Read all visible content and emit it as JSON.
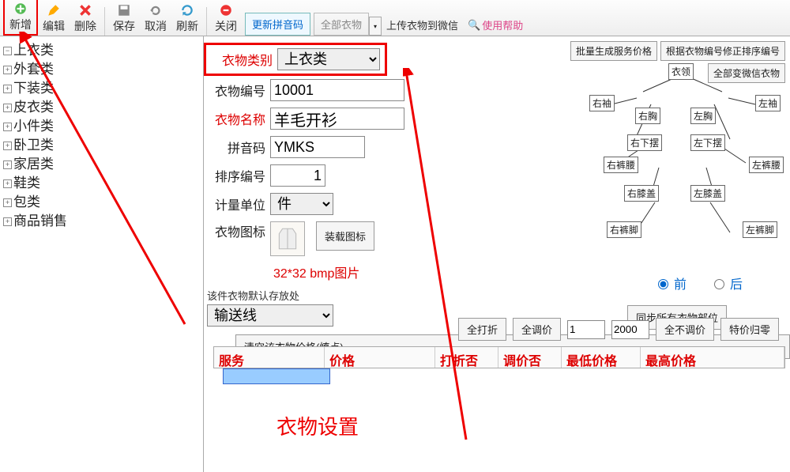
{
  "toolbar": {
    "new_label": "新增",
    "edit_label": "编辑",
    "delete_label": "删除",
    "save_label": "保存",
    "cancel_label": "取消",
    "refresh_label": "刷新",
    "close_label": "关闭",
    "update_pinyin": "更新拼音码",
    "all_clothes": "全部衣物",
    "upload_wechat": "上传衣物到微信",
    "help": "使用帮助"
  },
  "right_buttons": {
    "batch_price": "批量生成服务价格",
    "fix_sort": "根据衣物编号修正排序编号",
    "all_wechat": "全部变微信衣物"
  },
  "tree": {
    "items": [
      {
        "label": "上衣类"
      },
      {
        "label": "外套类"
      },
      {
        "label": "下装类"
      },
      {
        "label": "皮衣类"
      },
      {
        "label": "小件类"
      },
      {
        "label": "卧卫类"
      },
      {
        "label": "家居类"
      },
      {
        "label": "鞋类"
      },
      {
        "label": "包类"
      },
      {
        "label": "商品销售"
      }
    ]
  },
  "form": {
    "category_label": "衣物类别",
    "category_value": "上衣类",
    "number_label": "衣物编号",
    "number_value": "10001",
    "name_label": "衣物名称",
    "name_value": "羊毛开衫",
    "pinyin_label": "拼音码",
    "pinyin_value": "YMKS",
    "sort_label": "排序编号",
    "sort_value": "1",
    "unit_label": "计量单位",
    "unit_value": "件",
    "icon_label": "衣物图标",
    "load_icon": "装载图标",
    "icon_note": "32*32 bmp图片",
    "store_label": "该件衣物默认存放处",
    "store_value": "输送线",
    "clear_btn": "清空该衣物价格(慎点)"
  },
  "body_parts": {
    "collar": "衣领",
    "r_sleeve": "右袖",
    "l_sleeve": "左袖",
    "r_chest": "右胸",
    "l_chest": "左胸",
    "r_hem": "右下摆",
    "l_hem": "左下摆",
    "r_waist": "右裤腰",
    "l_waist": "左裤腰",
    "r_knee": "右膝盖",
    "l_knee": "左膝盖",
    "r_foot": "右裤脚",
    "l_foot": "左裤脚"
  },
  "view": {
    "front": "前",
    "back": "后",
    "selected": "front"
  },
  "sync_btn": "同步所有衣物部位",
  "pricebar": {
    "all_discount": "全打折",
    "all_adjust": "全调价",
    "v1": "1",
    "v2": "2000",
    "no_adjust": "全不调价",
    "special": "特价归零"
  },
  "table_headers": [
    "服务",
    "价格",
    "打折否",
    "调价否",
    "最低价格",
    "最高价格"
  ],
  "big_title": "衣物设置"
}
